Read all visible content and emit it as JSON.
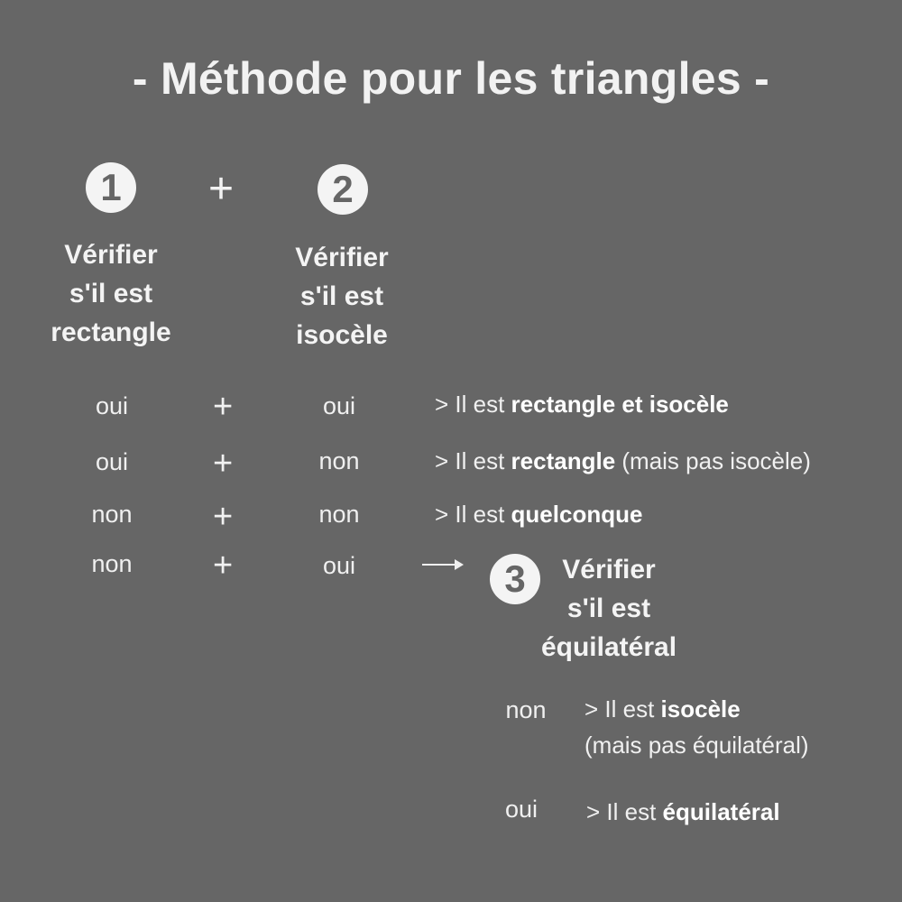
{
  "title": "- Méthode pour les triangles -",
  "step1": {
    "number": "1",
    "lines": [
      "Vérifier",
      "s'il est",
      "rectangle"
    ]
  },
  "plus": "+",
  "step2": {
    "number": "2",
    "lines": [
      "Vérifier",
      "s'il est",
      "isocèle"
    ]
  },
  "rows": [
    {
      "a": "oui",
      "b": "oui",
      "prefix": "> Il est ",
      "bold": "rectangle et isocèle",
      "suffix": ""
    },
    {
      "a": "oui",
      "b": "non",
      "prefix": "> Il est ",
      "bold": "rectangle",
      "suffix": " (mais pas isocèle)"
    },
    {
      "a": "non",
      "b": "non",
      "prefix": "> Il est ",
      "bold": "quelconque",
      "suffix": ""
    },
    {
      "a": "non",
      "b": "oui"
    }
  ],
  "step3": {
    "number": "3",
    "lines": [
      "Vérifier",
      "s'il est",
      "équilatéral"
    ]
  },
  "sub_rows": [
    {
      "answer": "non",
      "prefix": "> Il est  ",
      "bold": "isocèle",
      "note": "(mais pas équilatéral)"
    },
    {
      "answer": "oui",
      "prefix": "> Il est ",
      "bold": "équilatéral"
    }
  ]
}
